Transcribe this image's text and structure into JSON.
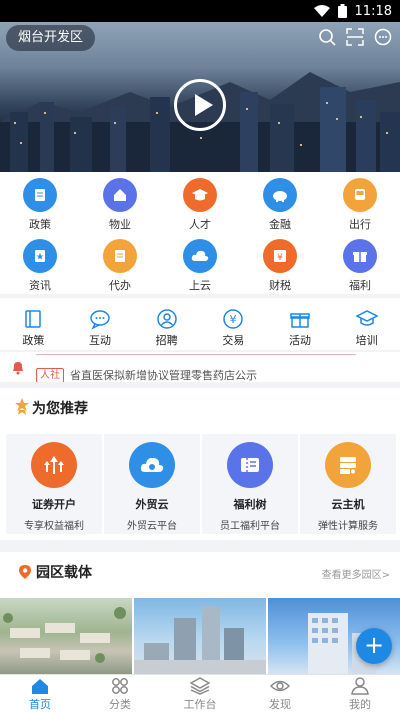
{
  "status_bar": {
    "time": "11:18"
  },
  "hero": {
    "location": "烟台开发区"
  },
  "services": [
    {
      "label": "政策",
      "color": "#2f8fe6"
    },
    {
      "label": "物业",
      "color": "#5a73e8"
    },
    {
      "label": "人才",
      "color": "#ef6b2c"
    },
    {
      "label": "金融",
      "color": "#2f8fe6"
    },
    {
      "label": "出行",
      "color": "#f2a43a"
    },
    {
      "label": "资讯",
      "color": "#2f8fe6"
    },
    {
      "label": "代办",
      "color": "#f2a43a"
    },
    {
      "label": "上云",
      "color": "#2f8fe6"
    },
    {
      "label": "财税",
      "color": "#ef6b2c"
    },
    {
      "label": "福利",
      "color": "#5a73e8"
    }
  ],
  "categories": [
    {
      "label": "政策"
    },
    {
      "label": "互动"
    },
    {
      "label": "招聘"
    },
    {
      "label": "交易"
    },
    {
      "label": "活动"
    },
    {
      "label": "培训"
    }
  ],
  "news": {
    "tag": "人社",
    "headline": "省直医保拟新增协议管理零售药店公示"
  },
  "recommend": {
    "title": "为您推荐",
    "cards": [
      {
        "name": "证券开户",
        "desc": "专享权益福利",
        "color": "#ef6b2c"
      },
      {
        "name": "外贸云",
        "desc": "外贸云平台",
        "color": "#2f8fe6"
      },
      {
        "name": "福利树",
        "desc": "员工福利平台",
        "color": "#5a73e8"
      },
      {
        "name": "云主机",
        "desc": "弹性计算服务",
        "color": "#f2a43a"
      }
    ]
  },
  "park": {
    "title": "园区载体",
    "more": "查看更多园区>"
  },
  "fab": {
    "label": "+"
  },
  "nav": [
    {
      "label": "首页"
    },
    {
      "label": "分类"
    },
    {
      "label": "工作台"
    },
    {
      "label": "发现"
    },
    {
      "label": "我的"
    }
  ],
  "colors": {
    "accent": "#1e88e5",
    "tag_red": "#e25a4b"
  }
}
